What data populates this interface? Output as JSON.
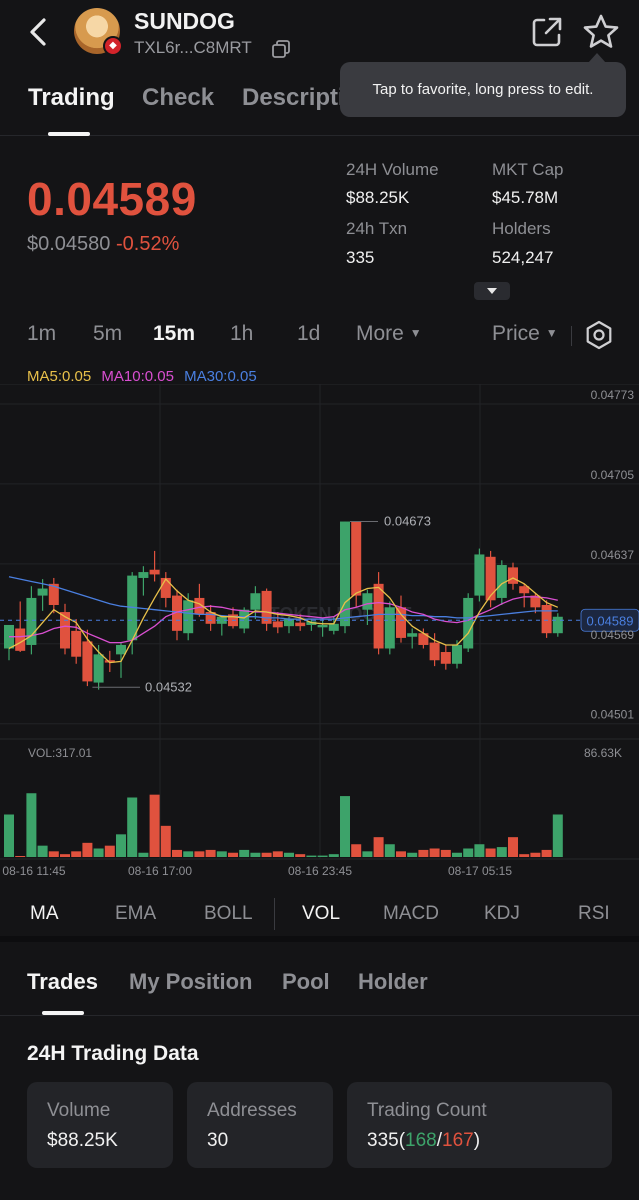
{
  "header": {
    "token_name": "SUNDOG",
    "token_address": "TXL6r...C8MRT",
    "icons": [
      "back-icon",
      "copy-icon",
      "share-icon",
      "star-icon"
    ]
  },
  "tooltip": {
    "text": "Tap to favorite, long press to edit."
  },
  "tabs": [
    {
      "label": "Trading",
      "active": true
    },
    {
      "label": "Check",
      "active": false
    },
    {
      "label": "Descripti",
      "active": false
    }
  ],
  "price": {
    "main": "0.04589",
    "usd": "$0.04580",
    "change": "-0.52%"
  },
  "stats": {
    "volume_label": "24H Volume",
    "volume_value": "$88.25K",
    "mktcap_label": "MKT Cap",
    "mktcap_value": "$45.78M",
    "txn_label": "24h Txn",
    "txn_value": "335",
    "holders_label": "Holders",
    "holders_value": "524,247"
  },
  "timeframes": {
    "items": [
      "1m",
      "5m",
      "15m",
      "1h",
      "1d",
      "More"
    ],
    "active": "15m",
    "price_selector": "Price"
  },
  "ma_legend": {
    "ma5": "MA5:0.05",
    "ma10": "MA10:0.05",
    "ma30": "MA30:0.05"
  },
  "colors": {
    "up": "#3da36a",
    "down": "#e0523e",
    "ma5": "#e8c04a",
    "ma10": "#d94fd1",
    "ma30": "#4a7fe0",
    "current_price": "#4a7fe0"
  },
  "chart_data": {
    "type": "candlestick",
    "price_axis_labels": [
      "0.04773",
      "0.04705",
      "0.04637",
      "0.04569",
      "0.04501"
    ],
    "current_price_label": "0.04589",
    "high_annotation": "0.04673",
    "low_annotation": "0.04532",
    "volume_label": "VOL:317.01",
    "volume_max_label": "86.63K",
    "time_labels": [
      "08-16 11:45",
      "08-16 17:00",
      "08-16 23:45",
      "08-17 05:15"
    ],
    "watermark": "TOKEN POCKET",
    "y_range": [
      0.04488,
      0.0479
    ],
    "candles": [
      {
        "o": 0.04565,
        "h": 0.04585,
        "l": 0.04555,
        "c": 0.04585
      },
      {
        "o": 0.04582,
        "h": 0.04605,
        "l": 0.04562,
        "c": 0.04563
      },
      {
        "o": 0.04568,
        "h": 0.04618,
        "l": 0.0456,
        "c": 0.04608
      },
      {
        "o": 0.0461,
        "h": 0.04624,
        "l": 0.04597,
        "c": 0.04616
      },
      {
        "o": 0.0462,
        "h": 0.04625,
        "l": 0.04595,
        "c": 0.04602
      },
      {
        "o": 0.04596,
        "h": 0.04603,
        "l": 0.0456,
        "c": 0.04565
      },
      {
        "o": 0.0458,
        "h": 0.0459,
        "l": 0.04552,
        "c": 0.04558
      },
      {
        "o": 0.04571,
        "h": 0.04581,
        "l": 0.04533,
        "c": 0.04537
      },
      {
        "o": 0.04536,
        "h": 0.04568,
        "l": 0.0453,
        "c": 0.0456
      },
      {
        "o": 0.04555,
        "h": 0.04563,
        "l": 0.04545,
        "c": 0.04553
      },
      {
        "o": 0.0456,
        "h": 0.0457,
        "l": 0.0454,
        "c": 0.04568
      },
      {
        "o": 0.04572,
        "h": 0.0463,
        "l": 0.0456,
        "c": 0.04627
      },
      {
        "o": 0.04625,
        "h": 0.04635,
        "l": 0.0461,
        "c": 0.0463
      },
      {
        "o": 0.04632,
        "h": 0.04648,
        "l": 0.04622,
        "c": 0.04628
      },
      {
        "o": 0.04625,
        "h": 0.0463,
        "l": 0.046,
        "c": 0.04608
      },
      {
        "o": 0.0461,
        "h": 0.04615,
        "l": 0.04572,
        "c": 0.0458
      },
      {
        "o": 0.04578,
        "h": 0.04612,
        "l": 0.04572,
        "c": 0.04606
      },
      {
        "o": 0.04608,
        "h": 0.0462,
        "l": 0.04592,
        "c": 0.04594
      },
      {
        "o": 0.04596,
        "h": 0.04602,
        "l": 0.0458,
        "c": 0.04586
      },
      {
        "o": 0.04586,
        "h": 0.04593,
        "l": 0.04576,
        "c": 0.04592
      },
      {
        "o": 0.04594,
        "h": 0.046,
        "l": 0.04582,
        "c": 0.04584
      },
      {
        "o": 0.04582,
        "h": 0.046,
        "l": 0.04578,
        "c": 0.04598
      },
      {
        "o": 0.04598,
        "h": 0.04618,
        "l": 0.0459,
        "c": 0.04612
      },
      {
        "o": 0.04614,
        "h": 0.04616,
        "l": 0.0458,
        "c": 0.04586
      },
      {
        "o": 0.04588,
        "h": 0.04596,
        "l": 0.04578,
        "c": 0.04583
      },
      {
        "o": 0.04584,
        "h": 0.04592,
        "l": 0.04578,
        "c": 0.0459
      },
      {
        "o": 0.04587,
        "h": 0.04594,
        "l": 0.0458,
        "c": 0.04584
      },
      {
        "o": 0.04585,
        "h": 0.0459,
        "l": 0.0458,
        "c": 0.04588
      },
      {
        "o": 0.04583,
        "h": 0.0459,
        "l": 0.04575,
        "c": 0.04585
      },
      {
        "o": 0.0458,
        "h": 0.04592,
        "l": 0.04577,
        "c": 0.04586
      },
      {
        "o": 0.04584,
        "h": 0.04673,
        "l": 0.04578,
        "c": 0.04673
      },
      {
        "o": 0.04673,
        "h": 0.04673,
        "l": 0.046,
        "c": 0.0461
      },
      {
        "o": 0.04598,
        "h": 0.04615,
        "l": 0.04585,
        "c": 0.04612
      },
      {
        "o": 0.0462,
        "h": 0.0463,
        "l": 0.0456,
        "c": 0.04565
      },
      {
        "o": 0.04565,
        "h": 0.04605,
        "l": 0.0456,
        "c": 0.046
      },
      {
        "o": 0.046,
        "h": 0.0461,
        "l": 0.0457,
        "c": 0.04574
      },
      {
        "o": 0.04575,
        "h": 0.04582,
        "l": 0.04565,
        "c": 0.04578
      },
      {
        "o": 0.04578,
        "h": 0.04582,
        "l": 0.04565,
        "c": 0.04568
      },
      {
        "o": 0.0457,
        "h": 0.04578,
        "l": 0.0455,
        "c": 0.04555
      },
      {
        "o": 0.04562,
        "h": 0.04568,
        "l": 0.04547,
        "c": 0.04552
      },
      {
        "o": 0.04552,
        "h": 0.04572,
        "l": 0.04548,
        "c": 0.04568
      },
      {
        "o": 0.04565,
        "h": 0.04612,
        "l": 0.04562,
        "c": 0.04608
      },
      {
        "o": 0.0461,
        "h": 0.0465,
        "l": 0.04605,
        "c": 0.04645
      },
      {
        "o": 0.04643,
        "h": 0.04648,
        "l": 0.046,
        "c": 0.04606
      },
      {
        "o": 0.04608,
        "h": 0.0464,
        "l": 0.04602,
        "c": 0.04636
      },
      {
        "o": 0.04634,
        "h": 0.04638,
        "l": 0.04615,
        "c": 0.0462
      },
      {
        "o": 0.04618,
        "h": 0.0462,
        "l": 0.046,
        "c": 0.04612
      },
      {
        "o": 0.0461,
        "h": 0.04612,
        "l": 0.04595,
        "c": 0.046
      },
      {
        "o": 0.04602,
        "h": 0.04606,
        "l": 0.04574,
        "c": 0.04578
      },
      {
        "o": 0.04578,
        "h": 0.04595,
        "l": 0.04575,
        "c": 0.04592
      }
    ],
    "volumes": [
      30,
      0,
      45,
      8,
      4,
      2,
      4,
      10,
      6,
      8,
      16,
      42,
      3,
      44,
      22,
      5,
      4,
      4,
      5,
      4,
      3,
      5,
      3,
      3,
      4,
      3,
      2,
      1,
      1,
      2,
      43,
      9,
      4,
      14,
      9,
      4,
      3,
      5,
      6,
      5,
      3,
      6,
      9,
      6,
      7,
      14,
      2,
      3,
      5,
      30
    ],
    "ma5": [
      0.04565,
      0.0457,
      0.04576,
      0.04587,
      0.04598,
      0.04592,
      0.04587,
      0.04573,
      0.04562,
      0.04553,
      0.04554,
      0.04572,
      0.04591,
      0.04608,
      0.04624,
      0.04614,
      0.04606,
      0.04603,
      0.04596,
      0.04592,
      0.04592,
      0.04591,
      0.04597,
      0.04596,
      0.04594,
      0.04593,
      0.04591,
      0.04587,
      0.04586,
      0.04586,
      0.04604,
      0.04612,
      0.04616,
      0.04617,
      0.04608,
      0.04594,
      0.04584,
      0.04578,
      0.04572,
      0.04568,
      0.04568,
      0.04578,
      0.04596,
      0.0461,
      0.0462,
      0.04625,
      0.0462,
      0.04612,
      0.04604,
      0.046
    ],
    "ma10": [
      0.04575,
      0.04575,
      0.04576,
      0.04578,
      0.04582,
      0.04584,
      0.04583,
      0.04578,
      0.04574,
      0.0457,
      0.0457,
      0.04572,
      0.04578,
      0.04584,
      0.04592,
      0.04596,
      0.04598,
      0.046,
      0.04601,
      0.046,
      0.04598,
      0.04597,
      0.04596,
      0.04596,
      0.04595,
      0.04594,
      0.04593,
      0.04592,
      0.04591,
      0.04592,
      0.04598,
      0.046,
      0.04603,
      0.04604,
      0.04603,
      0.046,
      0.04596,
      0.04594,
      0.0459,
      0.04588,
      0.04587,
      0.04589,
      0.04594,
      0.04598,
      0.04603,
      0.04607,
      0.04609,
      0.04609,
      0.04608,
      0.04606
    ],
    "ma30": [
      0.04626,
      0.04624,
      0.04622,
      0.0462,
      0.04618,
      0.04615,
      0.04612,
      0.04609,
      0.04606,
      0.04603,
      0.04601,
      0.046,
      0.04599,
      0.04598,
      0.04597,
      0.04596,
      0.04595,
      0.04594,
      0.04594,
      0.04593,
      0.04592,
      0.04592,
      0.04592,
      0.04591,
      0.04591,
      0.0459,
      0.0459,
      0.0459,
      0.0459,
      0.0459,
      0.04591,
      0.04592,
      0.04593,
      0.04594,
      0.04594,
      0.04594,
      0.04593,
      0.04593,
      0.04592,
      0.04592,
      0.04591,
      0.04591,
      0.04592,
      0.04593,
      0.04594,
      0.04595,
      0.04596,
      0.04597,
      0.04597,
      0.04597
    ]
  },
  "indicators": {
    "items": [
      "MA",
      "EMA",
      "BOLL",
      "VOL",
      "MACD",
      "KDJ",
      "RSI"
    ],
    "active": [
      "MA",
      "VOL"
    ]
  },
  "sub_tabs": [
    {
      "label": "Trades",
      "active": true
    },
    {
      "label": "My Position",
      "active": false
    },
    {
      "label": "Pool",
      "active": false
    },
    {
      "label": "Holder",
      "active": false
    }
  ],
  "trading_data": {
    "title": "24H Trading Data",
    "volume_label": "Volume",
    "volume_value": "$88.25K",
    "addresses_label": "Addresses",
    "addresses_value": "30",
    "count_label": "Trading Count",
    "count_total": "335",
    "count_buys": "168",
    "count_sells": "167"
  }
}
